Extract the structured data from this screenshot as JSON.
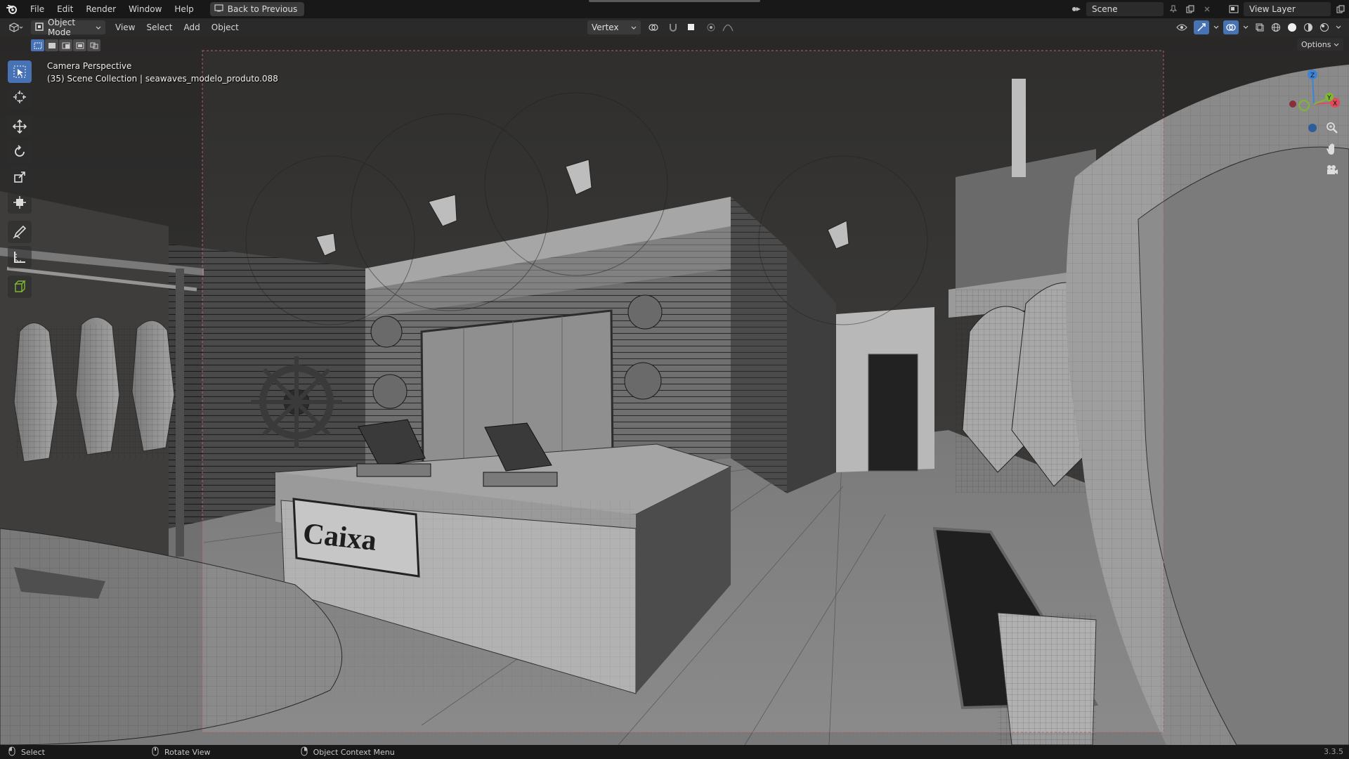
{
  "topbar": {
    "menus": [
      "File",
      "Edit",
      "Render",
      "Window",
      "Help"
    ],
    "back_label": "Back to Previous",
    "scene_name": "Scene",
    "view_layer": "View Layer"
  },
  "viewport_header": {
    "mode": "Object Mode",
    "menus": [
      "View",
      "Select",
      "Add",
      "Object"
    ],
    "snap_target": "Vertex",
    "options_label": "Options"
  },
  "overlay": {
    "view_name": "Camera Perspective",
    "collection_info": "(35) Scene Collection | seawaves_modelo_produto.088"
  },
  "scene": {
    "counter_sign": "Caixa"
  },
  "statusbar": {
    "select": "Select",
    "rotate": "Rotate View",
    "context_menu": "Object Context Menu",
    "version": "3.3.5"
  },
  "colors": {
    "accent": "#4772b3",
    "axis_x": "#e04a5a",
    "axis_y": "#7fb832",
    "axis_z": "#3e83d6"
  },
  "icons": [
    "blender-logo-icon",
    "cursor-icon",
    "move-icon",
    "rotate-icon",
    "scale-icon",
    "transform-icon",
    "annotate-icon",
    "measure-icon",
    "add-cube-icon",
    "zoom-icon",
    "hand-icon",
    "camera-icon"
  ]
}
